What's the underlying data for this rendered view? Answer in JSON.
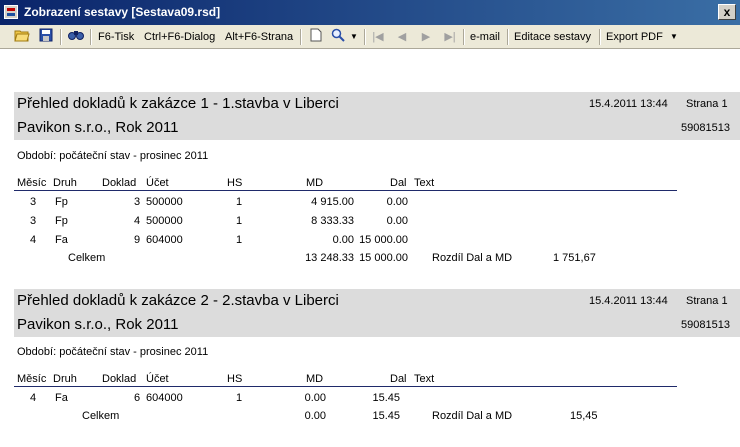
{
  "window": {
    "title": "Zobrazení sestavy [Sestava09.rsd]",
    "close_label": "x"
  },
  "toolbar": {
    "f6": "F6-Tisk",
    "ctrl_f6": "Ctrl+F6-Dialog",
    "alt_f6": "Alt+F6-Strana",
    "email": "e-mail",
    "edit": "Editace sestavy",
    "export": "Export PDF",
    "icons": [
      "open-folder-icon",
      "save-icon",
      "find-icon",
      "page-icon",
      "zoom-icon",
      "first-page-icon",
      "prev-page-icon",
      "next-page-icon",
      "last-page-icon"
    ]
  },
  "sections": [
    {
      "title": "Přehled dokladů k zakázce 1 - 1.stavba v Liberci",
      "subtitle": "Pavikon s.r.o., Rok 2011",
      "date": "15.4.2011 13:44",
      "page": "Strana 1",
      "code": "59081513",
      "period": "Období: počáteční stav - prosinec 2011",
      "columns": {
        "mesic": "Měsíc",
        "druh": "Druh",
        "doklad": "Doklad",
        "ucet": "Účet",
        "hs": "HS",
        "md": "MD",
        "dal": "Dal",
        "text": "Text"
      },
      "rows": [
        {
          "mesic": "3",
          "druh": "Fp",
          "doklad": "3",
          "ucet": "500000",
          "hs": "1",
          "md": "4 915.00",
          "dal": "0.00"
        },
        {
          "mesic": "3",
          "druh": "Fp",
          "doklad": "4",
          "ucet": "500000",
          "hs": "1",
          "md": "8 333.33",
          "dal": "0.00"
        },
        {
          "mesic": "4",
          "druh": "Fa",
          "doklad": "9",
          "ucet": "604000",
          "hs": "1",
          "md": "0.00",
          "dal": "15 000.00"
        }
      ],
      "total": {
        "label": "Celkem",
        "md": "13 248.33",
        "dal": "15 000.00",
        "diff_label": "Rozdíl Dal a MD",
        "diff": "1 751,67"
      }
    },
    {
      "title": "Přehled dokladů k zakázce 2 - 2.stavba v Liberci",
      "subtitle": "Pavikon s.r.o., Rok 2011",
      "date": "15.4.2011 13:44",
      "page": "Strana 1",
      "code": "59081513",
      "period": "Období: počáteční stav - prosinec 2011",
      "columns": {
        "mesic": "Měsíc",
        "druh": "Druh",
        "doklad": "Doklad",
        "ucet": "Účet",
        "hs": "HS",
        "md": "MD",
        "dal": "Dal",
        "text": "Text"
      },
      "rows": [
        {
          "mesic": "4",
          "druh": "Fa",
          "doklad": "6",
          "ucet": "604000",
          "hs": "1",
          "md": "0.00",
          "dal": "15.45"
        }
      ],
      "total": {
        "label": "Celkem",
        "md": "0.00",
        "dal": "15.45",
        "diff_label": "Rozdíl Dal a MD",
        "diff": "15,45"
      }
    }
  ]
}
